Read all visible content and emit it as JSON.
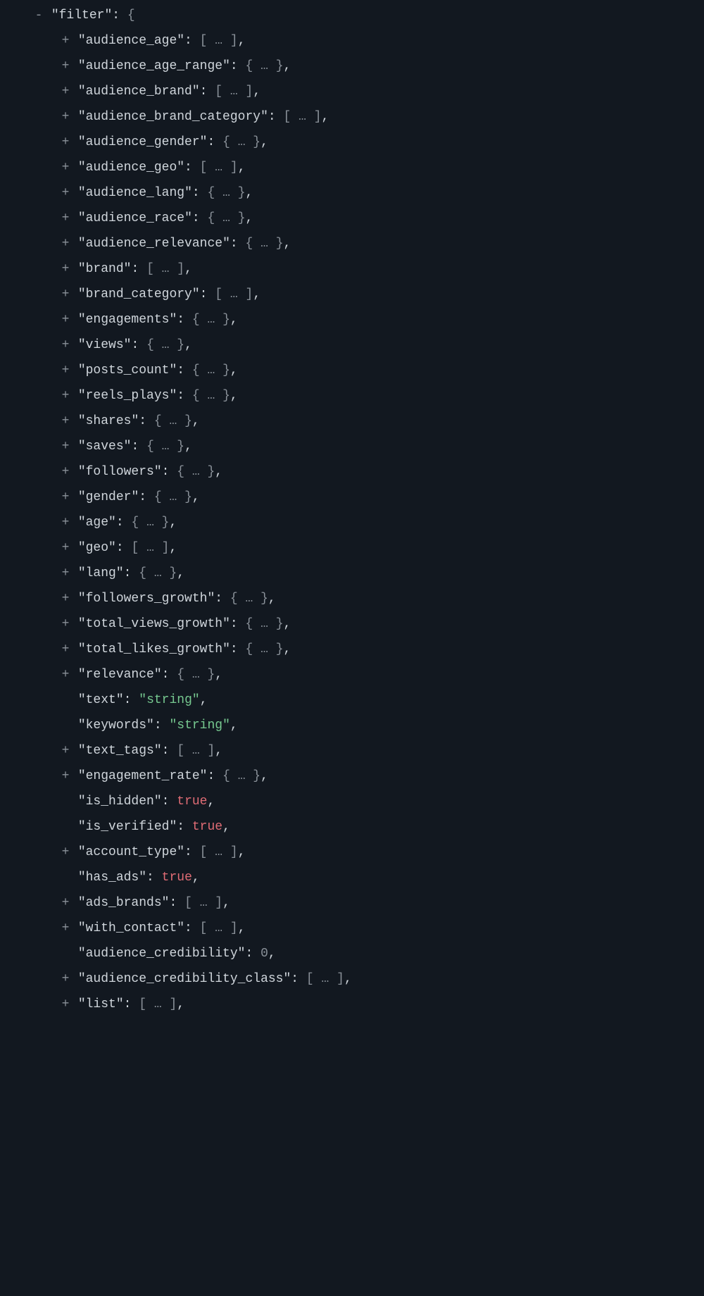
{
  "root": {
    "toggle": "-",
    "key": "filter",
    "open": "{"
  },
  "items": [
    {
      "toggle": "+",
      "key": "audience_age",
      "placeholder": "[ … ]",
      "trailing": ","
    },
    {
      "toggle": "+",
      "key": "audience_age_range",
      "placeholder": "{ … }",
      "trailing": ","
    },
    {
      "toggle": "+",
      "key": "audience_brand",
      "placeholder": "[ … ]",
      "trailing": ","
    },
    {
      "toggle": "+",
      "key": "audience_brand_category",
      "placeholder": "[ … ]",
      "trailing": ","
    },
    {
      "toggle": "+",
      "key": "audience_gender",
      "placeholder": "{ … }",
      "trailing": ","
    },
    {
      "toggle": "+",
      "key": "audience_geo",
      "placeholder": "[ … ]",
      "trailing": ","
    },
    {
      "toggle": "+",
      "key": "audience_lang",
      "placeholder": "{ … }",
      "trailing": ","
    },
    {
      "toggle": "+",
      "key": "audience_race",
      "placeholder": "{ … }",
      "trailing": ","
    },
    {
      "toggle": "+",
      "key": "audience_relevance",
      "placeholder": "{ … }",
      "trailing": ","
    },
    {
      "toggle": "+",
      "key": "brand",
      "placeholder": "[ … ]",
      "trailing": ","
    },
    {
      "toggle": "+",
      "key": "brand_category",
      "placeholder": "[ … ]",
      "trailing": ","
    },
    {
      "toggle": "+",
      "key": "engagements",
      "placeholder": "{ … }",
      "trailing": ","
    },
    {
      "toggle": "+",
      "key": "views",
      "placeholder": "{ … }",
      "trailing": ","
    },
    {
      "toggle": "+",
      "key": "posts_count",
      "placeholder": "{ … }",
      "trailing": ","
    },
    {
      "toggle": "+",
      "key": "reels_plays",
      "placeholder": "{ … }",
      "trailing": ","
    },
    {
      "toggle": "+",
      "key": "shares",
      "placeholder": "{ … }",
      "trailing": ","
    },
    {
      "toggle": "+",
      "key": "saves",
      "placeholder": "{ … }",
      "trailing": ","
    },
    {
      "toggle": "+",
      "key": "followers",
      "placeholder": "{ … }",
      "trailing": ","
    },
    {
      "toggle": "+",
      "key": "gender",
      "placeholder": "{ … }",
      "trailing": ","
    },
    {
      "toggle": "+",
      "key": "age",
      "placeholder": "{ … }",
      "trailing": ","
    },
    {
      "toggle": "+",
      "key": "geo",
      "placeholder": "[ … ]",
      "trailing": ","
    },
    {
      "toggle": "+",
      "key": "lang",
      "placeholder": "{ … }",
      "trailing": ","
    },
    {
      "toggle": "+",
      "key": "followers_growth",
      "placeholder": "{ … }",
      "trailing": ","
    },
    {
      "toggle": "+",
      "key": "total_views_growth",
      "placeholder": "{ … }",
      "trailing": ","
    },
    {
      "toggle": "+",
      "key": "total_likes_growth",
      "placeholder": "{ … }",
      "trailing": ","
    },
    {
      "toggle": "+",
      "key": "relevance",
      "placeholder": "{ … }",
      "trailing": ","
    },
    {
      "toggle": "",
      "key": "text",
      "value_type": "string",
      "value": "\"string\"",
      "trailing": ","
    },
    {
      "toggle": "",
      "key": "keywords",
      "value_type": "string",
      "value": "\"string\"",
      "trailing": ","
    },
    {
      "toggle": "+",
      "key": "text_tags",
      "placeholder": "[ … ]",
      "trailing": ","
    },
    {
      "toggle": "+",
      "key": "engagement_rate",
      "placeholder": "{ … }",
      "trailing": ","
    },
    {
      "toggle": "",
      "key": "is_hidden",
      "value_type": "bool",
      "value": "true",
      "trailing": ","
    },
    {
      "toggle": "",
      "key": "is_verified",
      "value_type": "bool",
      "value": "true",
      "trailing": ","
    },
    {
      "toggle": "+",
      "key": "account_type",
      "placeholder": "[ … ]",
      "trailing": ","
    },
    {
      "toggle": "",
      "key": "has_ads",
      "value_type": "bool",
      "value": "true",
      "trailing": ","
    },
    {
      "toggle": "+",
      "key": "ads_brands",
      "placeholder": "[ … ]",
      "trailing": ","
    },
    {
      "toggle": "+",
      "key": "with_contact",
      "placeholder": "[ … ]",
      "trailing": ","
    },
    {
      "toggle": "",
      "key": "audience_credibility",
      "value_type": "num",
      "value": "0",
      "trailing": ","
    },
    {
      "toggle": "+",
      "key": "audience_credibility_class",
      "placeholder": "[ … ]",
      "trailing": ","
    },
    {
      "toggle": "+",
      "key": "list",
      "placeholder": "[ … ]",
      "trailing": ","
    }
  ]
}
